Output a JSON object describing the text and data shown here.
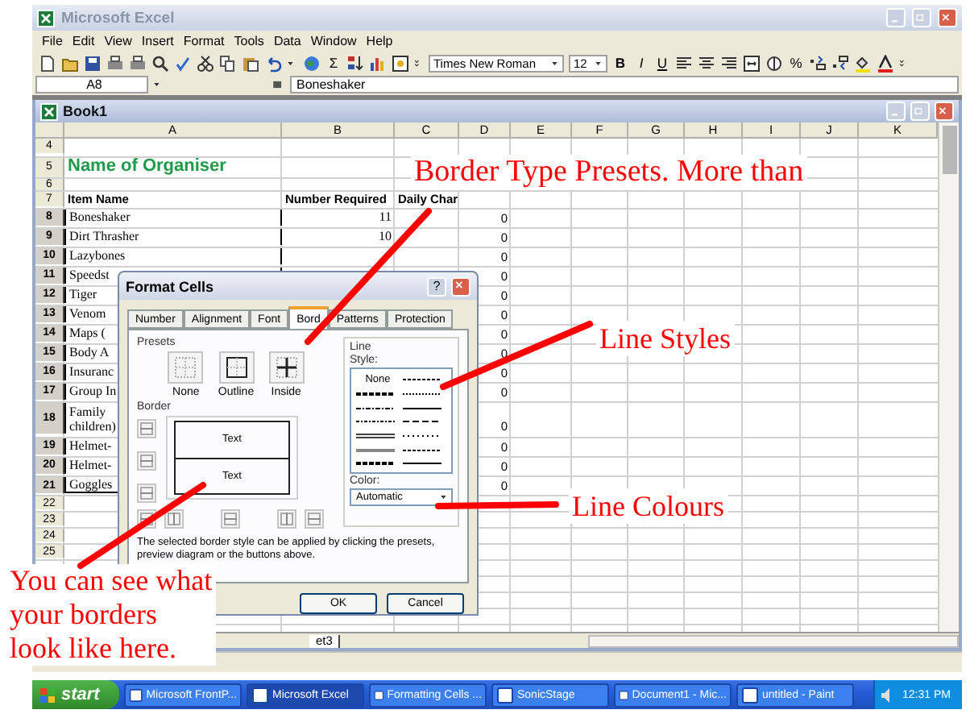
{
  "window": {
    "title": "Microsoft Excel"
  },
  "menu": [
    "File",
    "Edit",
    "View",
    "Insert",
    "Format",
    "Tools",
    "Data",
    "Window",
    "Help"
  ],
  "toolbar": {
    "sum": "Σ",
    "font": "Times New Roman",
    "size": "12",
    "bold": "B",
    "italic": "I",
    "underline": "U",
    "percent": "%"
  },
  "formula_bar": {
    "cell": "A8",
    "value": "Boneshaker"
  },
  "workbook": {
    "title": "Book1",
    "columns": [
      "A",
      "B",
      "C",
      "D",
      "E",
      "F",
      "G",
      "H",
      "I",
      "J",
      "K"
    ],
    "rows": [
      {
        "number": "4",
        "kind": "blank",
        "selected": false
      },
      {
        "number": "5",
        "kind": "title",
        "selected": false,
        "a": "Name of Organiser"
      },
      {
        "number": "6",
        "kind": "spacer",
        "selected": false
      },
      {
        "number": "7",
        "kind": "header",
        "selected": false,
        "a": "Item Name",
        "b": "Number Required",
        "c": "Daily Char"
      },
      {
        "number": "8",
        "kind": "data",
        "selected": true,
        "a": "Boneshaker",
        "b": "11",
        "d": "0"
      },
      {
        "number": "9",
        "kind": "data",
        "selected": true,
        "a": "Dirt Thrasher",
        "b": "10",
        "d": "0"
      },
      {
        "number": "10",
        "kind": "data",
        "selected": true,
        "a": "Lazybones",
        "d": "0"
      },
      {
        "number": "11",
        "kind": "data",
        "selected": true,
        "a": "Speedst",
        "d": "0"
      },
      {
        "number": "12",
        "kind": "data",
        "selected": true,
        "a": "Tiger",
        "d": "0"
      },
      {
        "number": "13",
        "kind": "data",
        "selected": true,
        "a": "Venom",
        "d": "0"
      },
      {
        "number": "14",
        "kind": "data",
        "selected": true,
        "a": "Maps (",
        "d": "0"
      },
      {
        "number": "15",
        "kind": "data",
        "selected": true,
        "a": "Body A",
        "d": "0"
      },
      {
        "number": "16",
        "kind": "data",
        "selected": true,
        "a": "Insuranc",
        "d": "0"
      },
      {
        "number": "17",
        "kind": "data",
        "selected": true,
        "a": "Group In",
        "d": "0"
      },
      {
        "number": "18",
        "kind": "wrapped",
        "selected": true,
        "lines": [
          "Family",
          "children)"
        ],
        "d": "0"
      },
      {
        "number": "19",
        "kind": "data",
        "selected": true,
        "a": "Helmet-",
        "d": "0"
      },
      {
        "number": "20",
        "kind": "data",
        "selected": true,
        "a": "Helmet-",
        "d": "0"
      },
      {
        "number": "21",
        "kind": "data",
        "selected": true,
        "a": "Goggles",
        "d": "0"
      },
      {
        "number": "22",
        "kind": "empty",
        "selected": false
      },
      {
        "number": "23",
        "kind": "empty",
        "selected": false
      },
      {
        "number": "24",
        "kind": "empty",
        "selected": false
      },
      {
        "number": "25",
        "kind": "empty",
        "selected": false
      }
    ],
    "sheet_tab": "et3"
  },
  "dialog": {
    "title": "Format Cells",
    "help": "?",
    "tabs": [
      {
        "label": "Number",
        "selected": false
      },
      {
        "label": "Alignment",
        "selected": false
      },
      {
        "label": "Font",
        "selected": false
      },
      {
        "label": "Bord",
        "selected": true
      },
      {
        "label": "Patterns",
        "selected": false
      },
      {
        "label": "Protection",
        "selected": false
      }
    ],
    "presets_label": "Presets",
    "presets": [
      "None",
      "Outline",
      "Inside"
    ],
    "border_label": "Border",
    "preview_texts": [
      "Text",
      "Text"
    ],
    "line_label": "Line",
    "style_label": "Style:",
    "style_none": "None",
    "color_label": "Color:",
    "color_value": "Automatic",
    "note": "The selected border style can be applied by clicking the presets, preview diagram or the buttons above.",
    "buttons": [
      "OK",
      "Cancel"
    ]
  },
  "annotations": [
    {
      "lines": [
        "Border Type Presets. More than"
      ]
    },
    {
      "lines": [
        "Line Styles"
      ]
    },
    {
      "lines": [
        "Line Colours"
      ]
    },
    {
      "lines": [
        "You can see what",
        "your borders",
        "look like here."
      ]
    }
  ],
  "taskbar": {
    "start": "start",
    "items": [
      {
        "label": "Microsoft FrontP...",
        "selected": false
      },
      {
        "label": "Microsoft Excel",
        "selected": true
      },
      {
        "label": "Formatting Cells ...",
        "selected": false
      },
      {
        "label": "SonicStage",
        "selected": false
      },
      {
        "label": "Document1 - Mic...",
        "selected": false
      },
      {
        "label": "untitled - Paint",
        "selected": false
      }
    ],
    "clock": "12:31 PM"
  }
}
